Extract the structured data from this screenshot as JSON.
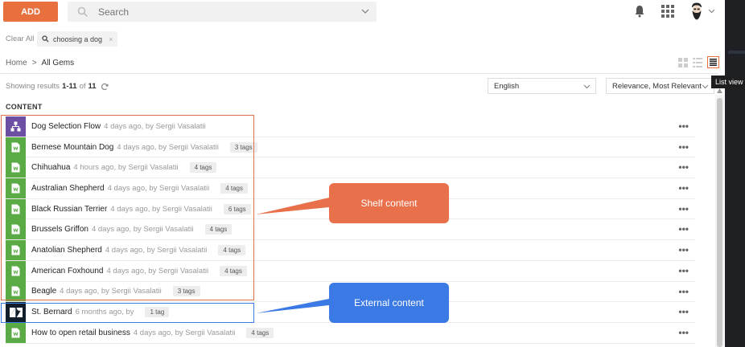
{
  "header": {
    "add_label": "ADD",
    "search_placeholder": "Search"
  },
  "filters": {
    "clear_all": "Clear All",
    "chip_label": "choosing a dog",
    "chip_close": "×"
  },
  "breadcrumb": {
    "home": "Home",
    "separator": ">",
    "current": "All Gems"
  },
  "view": {
    "tooltip": "List view"
  },
  "results": {
    "prefix": "Showing results",
    "range": "1-11",
    "of": "of",
    "total": "11"
  },
  "selects": {
    "language": "English",
    "sort": "Relevance, Most Relevant"
  },
  "section_title": "CONTENT",
  "rows": [
    {
      "icon": "flow-icon",
      "type": "purple",
      "title": "Dog Selection Flow",
      "meta": "4 days ago, by Sergii Vasalatii",
      "tag": ""
    },
    {
      "icon": "document-icon",
      "type": "green",
      "title": "Bernese Mountain Dog",
      "meta": "4 days ago, by Sergii Vasalatii",
      "tag": "3 tags"
    },
    {
      "icon": "document-icon",
      "type": "green",
      "title": "Chihuahua",
      "meta": "4 hours ago, by Sergii Vasalatii",
      "tag": "4 tags"
    },
    {
      "icon": "document-icon",
      "type": "green",
      "title": "Australian Shepherd",
      "meta": "4 days ago, by Sergii Vasalatii",
      "tag": "4 tags"
    },
    {
      "icon": "document-icon",
      "type": "green",
      "title": "Black Russian Terrier",
      "meta": "4 days ago, by Sergii Vasalatii",
      "tag": "6 tags"
    },
    {
      "icon": "document-icon",
      "type": "green",
      "title": "Brussels Griffon",
      "meta": "4 days ago, by Sergii Vasalatii",
      "tag": "4 tags"
    },
    {
      "icon": "document-icon",
      "type": "green",
      "title": "Anatolian Shepherd",
      "meta": "4 days ago, by Sergii Vasalatii",
      "tag": "4 tags"
    },
    {
      "icon": "document-icon",
      "type": "green",
      "title": "American Foxhound",
      "meta": "4 days ago, by Sergii Vasalatii",
      "tag": "4 tags"
    },
    {
      "icon": "document-icon",
      "type": "green",
      "title": "Beagle",
      "meta": "4 days ago, by Sergii Vasalatii",
      "tag": "3 tags"
    },
    {
      "icon": "zendesk-icon",
      "type": "dark",
      "title": "St. Bernard",
      "meta": "6 months ago, by",
      "tag": "1 tag"
    },
    {
      "icon": "document-icon",
      "type": "green",
      "title": "How to open retail business",
      "meta": "4 days ago, by Sergii Vasalatii",
      "tag": "4 tags"
    }
  ],
  "more_label": "•••",
  "callouts": {
    "shelf": "Shelf content",
    "external": "External content"
  },
  "colors": {
    "accent": "#e8703f",
    "green": "#5aab45",
    "purple": "#6c4fa3",
    "dark": "#101f2b",
    "blue": "#3b79e4"
  }
}
